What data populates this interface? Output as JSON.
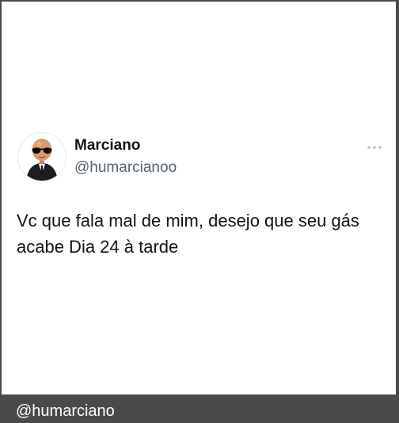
{
  "tweet": {
    "display_name": "Marciano",
    "handle": "@humarcianoo",
    "text_lines": [
      "Vc que fala mal de mim, desejo que seu gás",
      "acabe Dia 24 à tarde"
    ],
    "more_icon": "more-horizontal-icon",
    "avatar_icon": "alien-in-suit-avatar"
  },
  "footer": {
    "watermark": "@humarciano"
  },
  "colors": {
    "background": "#4a4a4a",
    "card": "#ffffff",
    "text_primary": "#0f1419",
    "text_secondary": "#536471"
  }
}
